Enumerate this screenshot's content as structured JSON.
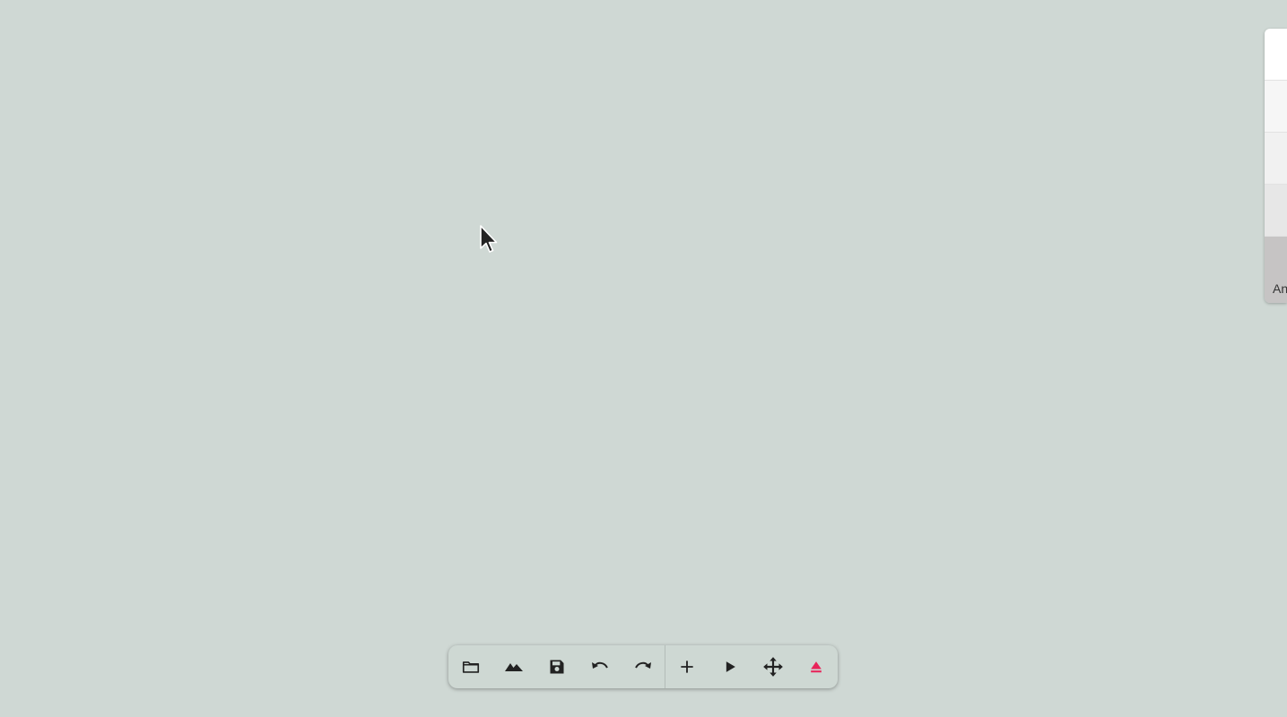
{
  "toolbar": {
    "buttons_left": [
      {
        "icon": "folder-icon",
        "action": "open"
      },
      {
        "icon": "landscape-icon",
        "action": "terrain"
      },
      {
        "icon": "save-icon",
        "action": "save"
      },
      {
        "icon": "undo-icon",
        "action": "undo"
      },
      {
        "icon": "redo-icon",
        "action": "redo"
      }
    ],
    "buttons_right": [
      {
        "icon": "plus-icon",
        "action": "add"
      },
      {
        "icon": "play-icon",
        "action": "play"
      },
      {
        "icon": "move-icon",
        "action": "move"
      },
      {
        "icon": "eject-icon",
        "action": "eject",
        "color": "#e8245a"
      }
    ]
  },
  "side_panel": {
    "partial_label": "An"
  },
  "colors": {
    "background": "#cfd8d4",
    "icon": "#222222",
    "accent": "#e8245a"
  }
}
